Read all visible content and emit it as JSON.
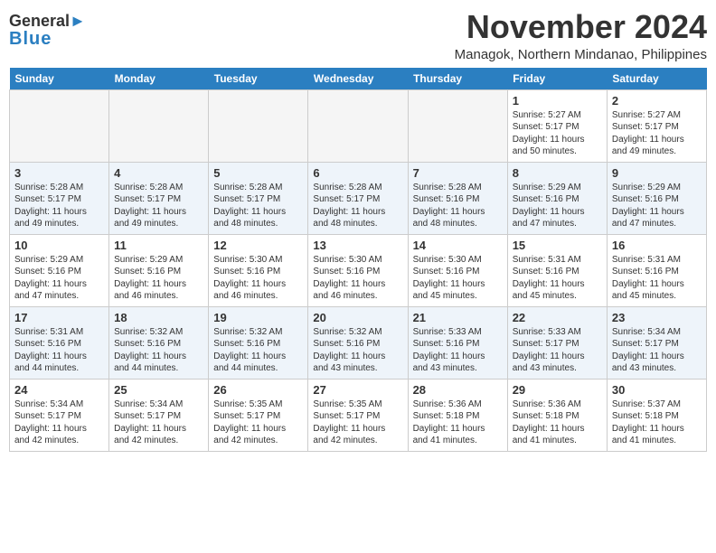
{
  "header": {
    "logo_line1": "General",
    "logo_line2": "Blue",
    "month": "November 2024",
    "location": "Managok, Northern Mindanao, Philippines"
  },
  "days_of_week": [
    "Sunday",
    "Monday",
    "Tuesday",
    "Wednesday",
    "Thursday",
    "Friday",
    "Saturday"
  ],
  "weeks": [
    [
      {
        "day": "",
        "info": ""
      },
      {
        "day": "",
        "info": ""
      },
      {
        "day": "",
        "info": ""
      },
      {
        "day": "",
        "info": ""
      },
      {
        "day": "",
        "info": ""
      },
      {
        "day": "1",
        "info": "Sunrise: 5:27 AM\nSunset: 5:17 PM\nDaylight: 11 hours\nand 50 minutes."
      },
      {
        "day": "2",
        "info": "Sunrise: 5:27 AM\nSunset: 5:17 PM\nDaylight: 11 hours\nand 49 minutes."
      }
    ],
    [
      {
        "day": "3",
        "info": "Sunrise: 5:28 AM\nSunset: 5:17 PM\nDaylight: 11 hours\nand 49 minutes."
      },
      {
        "day": "4",
        "info": "Sunrise: 5:28 AM\nSunset: 5:17 PM\nDaylight: 11 hours\nand 49 minutes."
      },
      {
        "day": "5",
        "info": "Sunrise: 5:28 AM\nSunset: 5:17 PM\nDaylight: 11 hours\nand 48 minutes."
      },
      {
        "day": "6",
        "info": "Sunrise: 5:28 AM\nSunset: 5:17 PM\nDaylight: 11 hours\nand 48 minutes."
      },
      {
        "day": "7",
        "info": "Sunrise: 5:28 AM\nSunset: 5:16 PM\nDaylight: 11 hours\nand 48 minutes."
      },
      {
        "day": "8",
        "info": "Sunrise: 5:29 AM\nSunset: 5:16 PM\nDaylight: 11 hours\nand 47 minutes."
      },
      {
        "day": "9",
        "info": "Sunrise: 5:29 AM\nSunset: 5:16 PM\nDaylight: 11 hours\nand 47 minutes."
      }
    ],
    [
      {
        "day": "10",
        "info": "Sunrise: 5:29 AM\nSunset: 5:16 PM\nDaylight: 11 hours\nand 47 minutes."
      },
      {
        "day": "11",
        "info": "Sunrise: 5:29 AM\nSunset: 5:16 PM\nDaylight: 11 hours\nand 46 minutes."
      },
      {
        "day": "12",
        "info": "Sunrise: 5:30 AM\nSunset: 5:16 PM\nDaylight: 11 hours\nand 46 minutes."
      },
      {
        "day": "13",
        "info": "Sunrise: 5:30 AM\nSunset: 5:16 PM\nDaylight: 11 hours\nand 46 minutes."
      },
      {
        "day": "14",
        "info": "Sunrise: 5:30 AM\nSunset: 5:16 PM\nDaylight: 11 hours\nand 45 minutes."
      },
      {
        "day": "15",
        "info": "Sunrise: 5:31 AM\nSunset: 5:16 PM\nDaylight: 11 hours\nand 45 minutes."
      },
      {
        "day": "16",
        "info": "Sunrise: 5:31 AM\nSunset: 5:16 PM\nDaylight: 11 hours\nand 45 minutes."
      }
    ],
    [
      {
        "day": "17",
        "info": "Sunrise: 5:31 AM\nSunset: 5:16 PM\nDaylight: 11 hours\nand 44 minutes."
      },
      {
        "day": "18",
        "info": "Sunrise: 5:32 AM\nSunset: 5:16 PM\nDaylight: 11 hours\nand 44 minutes."
      },
      {
        "day": "19",
        "info": "Sunrise: 5:32 AM\nSunset: 5:16 PM\nDaylight: 11 hours\nand 44 minutes."
      },
      {
        "day": "20",
        "info": "Sunrise: 5:32 AM\nSunset: 5:16 PM\nDaylight: 11 hours\nand 43 minutes."
      },
      {
        "day": "21",
        "info": "Sunrise: 5:33 AM\nSunset: 5:16 PM\nDaylight: 11 hours\nand 43 minutes."
      },
      {
        "day": "22",
        "info": "Sunrise: 5:33 AM\nSunset: 5:17 PM\nDaylight: 11 hours\nand 43 minutes."
      },
      {
        "day": "23",
        "info": "Sunrise: 5:34 AM\nSunset: 5:17 PM\nDaylight: 11 hours\nand 43 minutes."
      }
    ],
    [
      {
        "day": "24",
        "info": "Sunrise: 5:34 AM\nSunset: 5:17 PM\nDaylight: 11 hours\nand 42 minutes."
      },
      {
        "day": "25",
        "info": "Sunrise: 5:34 AM\nSunset: 5:17 PM\nDaylight: 11 hours\nand 42 minutes."
      },
      {
        "day": "26",
        "info": "Sunrise: 5:35 AM\nSunset: 5:17 PM\nDaylight: 11 hours\nand 42 minutes."
      },
      {
        "day": "27",
        "info": "Sunrise: 5:35 AM\nSunset: 5:17 PM\nDaylight: 11 hours\nand 42 minutes."
      },
      {
        "day": "28",
        "info": "Sunrise: 5:36 AM\nSunset: 5:18 PM\nDaylight: 11 hours\nand 41 minutes."
      },
      {
        "day": "29",
        "info": "Sunrise: 5:36 AM\nSunset: 5:18 PM\nDaylight: 11 hours\nand 41 minutes."
      },
      {
        "day": "30",
        "info": "Sunrise: 5:37 AM\nSunset: 5:18 PM\nDaylight: 11 hours\nand 41 minutes."
      }
    ]
  ]
}
